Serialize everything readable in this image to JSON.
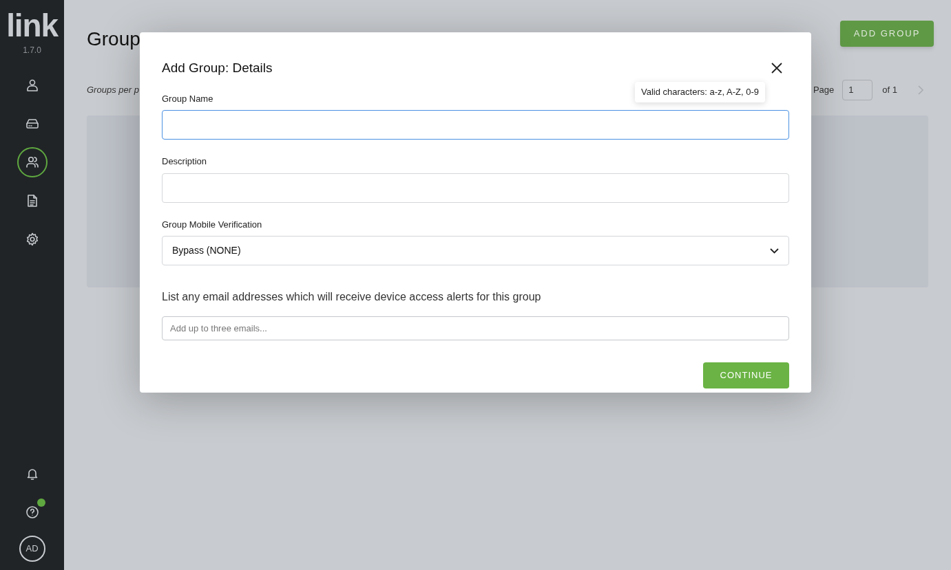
{
  "sidebar": {
    "logo": "link",
    "version": "1.7.0",
    "nav_items": [
      {
        "kind": "person",
        "selected": false
      },
      {
        "kind": "drive",
        "selected": false
      },
      {
        "kind": "group",
        "selected": true
      },
      {
        "kind": "document",
        "selected": false
      },
      {
        "kind": "gear",
        "selected": false
      }
    ],
    "bottom_items": [
      {
        "kind": "bell",
        "badge": false
      },
      {
        "kind": "help",
        "badge": true
      }
    ],
    "avatar": "AD"
  },
  "page": {
    "title": "Group",
    "add_button": "ADD GROUP",
    "per_page_label": "Groups per p",
    "pagination": {
      "label": "Page",
      "value": "1",
      "of": "of 1"
    }
  },
  "modal": {
    "title": "Add Group: Details",
    "tooltip": "Valid characters: a-z, A-Z, 0-9",
    "fields": [
      {
        "kind": "text",
        "label": "Group Name",
        "focused": true
      },
      {
        "kind": "text",
        "label": "Description",
        "focused": false
      },
      {
        "kind": "select",
        "label": "Group Mobile Verification",
        "value": "Bypass (NONE)",
        "focused": false
      }
    ],
    "email_prompt": "List any email addresses which will receive device access alerts for this group",
    "email_placeholder": "Add up to three emails...",
    "continue_button": "CONTINUE"
  }
}
